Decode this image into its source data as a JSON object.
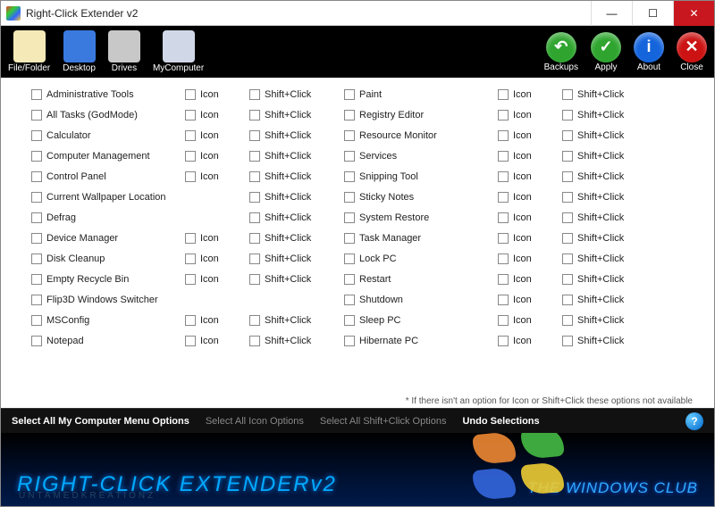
{
  "window": {
    "title": "Right-Click Extender v2"
  },
  "toolbar_left": [
    {
      "key": "filefolder",
      "label": "File/Folder",
      "bg": "#f5e9b8"
    },
    {
      "key": "desktop",
      "label": "Desktop",
      "bg": "#3a7adf"
    },
    {
      "key": "drives",
      "label": "Drives",
      "bg": "#c8c8c8"
    },
    {
      "key": "mycomputer",
      "label": "MyComputer",
      "bg": "#d0d8e8"
    }
  ],
  "toolbar_right": [
    {
      "key": "backups",
      "label": "Backups",
      "bg": "#2fa52f",
      "glyph": "↶"
    },
    {
      "key": "apply",
      "label": "Apply",
      "bg": "#2fa52f",
      "glyph": "✓"
    },
    {
      "key": "about",
      "label": "About",
      "bg": "#1464dc",
      "glyph": "i"
    },
    {
      "key": "close",
      "label": "Close",
      "bg": "#cc1212",
      "glyph": "✕"
    }
  ],
  "options": {
    "icon_label": "Icon",
    "shift_label": "Shift+Click",
    "left": [
      {
        "name": "Administrative Tools",
        "icon": true,
        "shift": true
      },
      {
        "name": "All Tasks (GodMode)",
        "icon": true,
        "shift": true
      },
      {
        "name": "Calculator",
        "icon": true,
        "shift": true
      },
      {
        "name": "Computer Management",
        "icon": true,
        "shift": true
      },
      {
        "name": "Control Panel",
        "icon": true,
        "shift": true
      },
      {
        "name": "Current Wallpaper Location",
        "icon": false,
        "shift": true
      },
      {
        "name": "Defrag",
        "icon": false,
        "shift": true
      },
      {
        "name": "Device Manager",
        "icon": true,
        "shift": true
      },
      {
        "name": "Disk Cleanup",
        "icon": true,
        "shift": true
      },
      {
        "name": "Empty Recycle Bin",
        "icon": true,
        "shift": true
      },
      {
        "name": "Flip3D Windows Switcher",
        "icon": false,
        "shift": false
      },
      {
        "name": "MSConfig",
        "icon": true,
        "shift": true
      },
      {
        "name": "Notepad",
        "icon": true,
        "shift": true
      }
    ],
    "right": [
      {
        "name": "Paint",
        "icon": true,
        "shift": true
      },
      {
        "name": "Registry Editor",
        "icon": true,
        "shift": true
      },
      {
        "name": "Resource Monitor",
        "icon": true,
        "shift": true
      },
      {
        "name": "Services",
        "icon": true,
        "shift": true
      },
      {
        "name": "Snipping Tool",
        "icon": true,
        "shift": true
      },
      {
        "name": "Sticky Notes",
        "icon": true,
        "shift": true
      },
      {
        "name": "System Restore",
        "icon": true,
        "shift": true
      },
      {
        "name": "Task Manager",
        "icon": true,
        "shift": true
      },
      {
        "name": "Lock PC",
        "icon": true,
        "shift": true
      },
      {
        "name": "Restart",
        "icon": true,
        "shift": true
      },
      {
        "name": "Shutdown",
        "icon": true,
        "shift": true
      },
      {
        "name": "Sleep PC",
        "icon": true,
        "shift": true
      },
      {
        "name": "Hibernate PC",
        "icon": true,
        "shift": true
      }
    ]
  },
  "note": "* If there isn't an option for Icon or Shift+Click these options not available",
  "footer": {
    "items": [
      {
        "label": "Select All My Computer Menu Options",
        "active": true
      },
      {
        "label": "Select All Icon Options",
        "active": false
      },
      {
        "label": "Select All Shift+Click Options",
        "active": false
      },
      {
        "label": "Undo Selections",
        "active": true
      }
    ]
  },
  "brand": {
    "title": "RIGHT-CLICK EXTENDERv2",
    "sub": "UNTAMEDKREATIONZ",
    "club": "THE WINDOWS CLUB"
  }
}
